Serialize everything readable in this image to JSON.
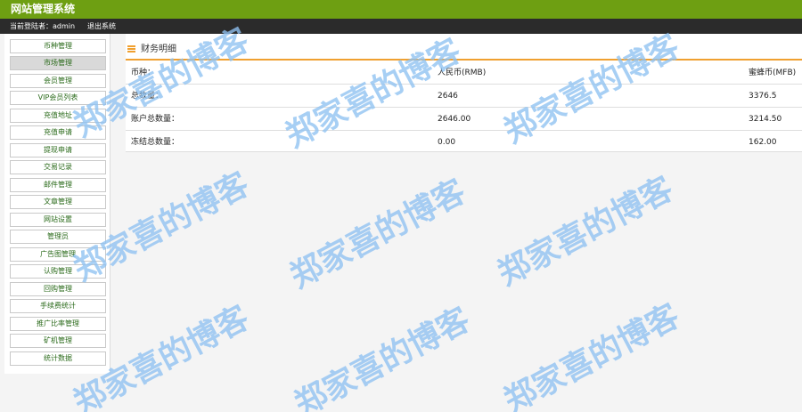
{
  "header": {
    "title": "网站管理系统",
    "user_label": "当前登陆者：admin",
    "logout_label": "退出系统"
  },
  "sidebar": {
    "active_index": 1,
    "items": [
      {
        "label": "币种管理"
      },
      {
        "label": "市场管理"
      },
      {
        "label": "会员管理"
      },
      {
        "label": "VIP会员列表"
      },
      {
        "label": "充值地址"
      },
      {
        "label": "充值申请"
      },
      {
        "label": "提现申请"
      },
      {
        "label": "交易记录"
      },
      {
        "label": "邮件管理"
      },
      {
        "label": "文章管理"
      },
      {
        "label": "网站设置"
      },
      {
        "label": "管理员"
      },
      {
        "label": "广告图管理"
      },
      {
        "label": "认购管理"
      },
      {
        "label": "回购管理"
      },
      {
        "label": "手续费统计"
      },
      {
        "label": "推广比率管理"
      },
      {
        "label": "矿机管理"
      },
      {
        "label": "统计数据"
      }
    ]
  },
  "panel": {
    "title": "财务明细",
    "header_row": {
      "c1": "币种：",
      "c2": "人民币(RMB)",
      "c3": "蜜蜂币(MFB)"
    },
    "rows": [
      {
        "c1": "总数量：",
        "c2": "2646",
        "c3": "3376.5"
      },
      {
        "c1": "账户总数量：",
        "c2": "2646.00",
        "c3": "3214.50"
      },
      {
        "c1": "冻结总数量：",
        "c2": "0.00",
        "c3": "162.00"
      }
    ]
  },
  "watermark": {
    "text": "郑家喜的博客"
  },
  "colors": {
    "topbar": "#6e9f12",
    "userbar": "#2b2b2b",
    "accent": "#f0a030",
    "sidebar_text": "#2a6a1a",
    "watermark": "#8fc2f2"
  }
}
